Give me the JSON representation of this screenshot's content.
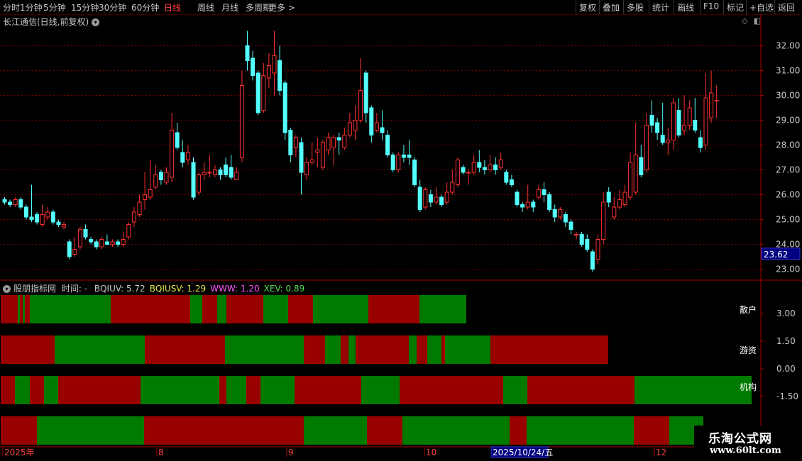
{
  "toolbar": {
    "periods": [
      "分时",
      "1分钟",
      "5分钟",
      "15分钟",
      "30分钟",
      "60分钟",
      "日线",
      "周线",
      "月线",
      "多周期",
      "更多 >"
    ],
    "active_period": "日线",
    "right_buttons": [
      "复权",
      "叠加",
      "多股",
      "统计",
      "画线",
      "F10",
      "标记",
      "+自选",
      "返回"
    ]
  },
  "chart_header": {
    "stock_title": "长江通信(日线,前复权)"
  },
  "indicator": {
    "name": "股朋指标网",
    "time_label": "时间: -",
    "values": [
      {
        "label": "BQIUV: 5.72",
        "color": "#c8c8c8"
      },
      {
        "label": "BQIUSV: 1.29",
        "color": "#e8e84a"
      },
      {
        "label": "WWW: 1.20",
        "color": "#ff55ff"
      },
      {
        "label": "XEV: 0.89",
        "color": "#55dd55"
      }
    ],
    "band_labels": [
      "散户",
      "游资",
      "机构"
    ],
    "y_labels": [
      "3.00",
      "1.50",
      "0.00",
      "-1.50"
    ],
    "bands": [
      {
        "name": "band-sanhu",
        "segments": [
          [
            "r",
            24
          ],
          [
            "g",
            3
          ],
          [
            "r",
            4
          ],
          [
            "g",
            3
          ],
          [
            "r",
            7
          ],
          [
            "g",
            114
          ],
          [
            "r",
            112
          ],
          [
            "g",
            17
          ],
          [
            "r",
            21
          ],
          [
            "g",
            13
          ],
          [
            "r",
            52
          ],
          [
            "g",
            35
          ],
          [
            "r",
            35
          ],
          [
            "g",
            78
          ],
          [
            "r",
            72
          ],
          [
            "g",
            66
          ]
        ]
      },
      {
        "name": "band-youzi",
        "segments": [
          [
            "r",
            76
          ],
          [
            "g",
            127
          ],
          [
            "r",
            113
          ],
          [
            "g",
            111
          ],
          [
            "r",
            30
          ],
          [
            "g",
            22
          ],
          [
            "r",
            11
          ],
          [
            "g",
            10
          ],
          [
            "r",
            75
          ],
          [
            "g",
            11
          ],
          [
            "r",
            15
          ],
          [
            "g",
            20
          ],
          [
            "r",
            5
          ],
          [
            "g",
            64
          ],
          [
            "r",
            166
          ]
        ]
      },
      {
        "name": "band-jigou",
        "segments": [
          [
            "r",
            20
          ],
          [
            "g",
            21
          ],
          [
            "r",
            20
          ],
          [
            "g",
            20
          ],
          [
            "r",
            116
          ],
          [
            "g",
            111
          ],
          [
            "r",
            10
          ],
          [
            "g",
            28
          ],
          [
            "r",
            20
          ],
          [
            "g",
            48
          ],
          [
            "r",
            94
          ],
          [
            "g",
            54
          ],
          [
            "r",
            146
          ],
          [
            "g",
            34
          ],
          [
            "r",
            151
          ],
          [
            "g",
            165
          ]
        ]
      },
      {
        "name": "band-bottom",
        "segments": [
          [
            "r",
            51
          ],
          [
            "g",
            151
          ],
          [
            "r",
            225
          ],
          [
            "g",
            89
          ],
          [
            "r",
            50
          ],
          [
            "g",
            151
          ],
          [
            "r",
            24
          ],
          [
            "g",
            151
          ],
          [
            "r",
            50
          ],
          [
            "g",
            48
          ]
        ]
      }
    ]
  },
  "price_axis": {
    "labels": [
      "32.00",
      "31.00",
      "30.00",
      "29.00",
      "28.00",
      "27.00",
      "26.00",
      "25.00",
      "24.00",
      "23.00"
    ],
    "current_price": "23.62"
  },
  "date_axis": {
    "labels": [
      "2025年",
      "8",
      "9",
      "10",
      "2025/10/24/五",
      "12"
    ]
  },
  "watermark": {
    "title": "乐淘公式网",
    "url": "www.60lt.com"
  },
  "chart_data": {
    "type": "candlestick",
    "y_range": [
      22.7,
      32.7
    ],
    "colors": {
      "up": "#ff3030",
      "down": "#54ffff"
    },
    "candles": [
      [
        25.8,
        25.7,
        25.9,
        25.6
      ],
      [
        25.7,
        25.6,
        25.8,
        25.5
      ],
      [
        25.6,
        25.8,
        25.9,
        25.5
      ],
      [
        25.8,
        25.5,
        25.9,
        25.4
      ],
      [
        25.5,
        25.1,
        25.6,
        25.0
      ],
      [
        25.1,
        25.0,
        26.4,
        24.9
      ],
      [
        25.2,
        24.9,
        25.3,
        24.8
      ],
      [
        24.8,
        25.2,
        25.6,
        24.7
      ],
      [
        25.1,
        25.3,
        25.5,
        25.0
      ],
      [
        25.3,
        24.9,
        25.4,
        24.8
      ],
      [
        24.9,
        24.8,
        25.0,
        24.7
      ],
      [
        24.7,
        24.8,
        24.9,
        24.6
      ],
      [
        24.1,
        23.5,
        24.2,
        23.4
      ],
      [
        23.6,
        23.8,
        24.3,
        23.5
      ],
      [
        23.9,
        24.6,
        24.7,
        23.8
      ],
      [
        24.6,
        24.3,
        24.8,
        24.2
      ],
      [
        24.2,
        24.1,
        24.3,
        24.0
      ],
      [
        24.1,
        23.9,
        24.2,
        23.8
      ],
      [
        23.9,
        24.2,
        24.3,
        23.8
      ],
      [
        24.1,
        24.0,
        24.4,
        24.0
      ],
      [
        24.0,
        24.1,
        24.2,
        23.9
      ],
      [
        24.1,
        24.0,
        24.2,
        23.9
      ],
      [
        24.0,
        24.2,
        24.5,
        23.9
      ],
      [
        24.3,
        24.8,
        24.9,
        24.2
      ],
      [
        24.9,
        25.3,
        25.5,
        24.7
      ],
      [
        25.2,
        25.7,
        26.0,
        25.1
      ],
      [
        25.8,
        26.0,
        26.9,
        25.4
      ],
      [
        25.9,
        26.2,
        27.4,
        25.8
      ],
      [
        26.3,
        26.8,
        27.2,
        26.2
      ],
      [
        26.9,
        26.6,
        27.0,
        26.4
      ],
      [
        26.5,
        26.9,
        27.1,
        26.4
      ],
      [
        26.7,
        28.6,
        29.3,
        26.5
      ],
      [
        28.5,
        27.9,
        28.9,
        27.8
      ],
      [
        27.7,
        27.3,
        28.2,
        27.1
      ],
      [
        27.4,
        27.7,
        28.0,
        27.2
      ],
      [
        27.3,
        25.9,
        27.5,
        25.8
      ],
      [
        26.1,
        26.8,
        26.9,
        26.0
      ],
      [
        26.8,
        26.9,
        27.3,
        26.6
      ],
      [
        26.9,
        26.9,
        27.6,
        26.7
      ],
      [
        26.8,
        27.0,
        27.2,
        26.7
      ],
      [
        27.0,
        26.8,
        27.1,
        26.6
      ],
      [
        27.2,
        26.8,
        27.5,
        26.7
      ],
      [
        27.1,
        26.7,
        27.6,
        26.6
      ],
      [
        26.6,
        26.9,
        27.1,
        26.6
      ],
      [
        27.5,
        30.4,
        31.0,
        27.3
      ],
      [
        32.0,
        31.4,
        32.6,
        31.0
      ],
      [
        31.5,
        30.8,
        31.8,
        30.6
      ],
      [
        30.9,
        29.3,
        31.0,
        29.2
      ],
      [
        29.4,
        30.8,
        31.3,
        29.3
      ],
      [
        30.7,
        31.2,
        31.7,
        30.3
      ],
      [
        30.9,
        31.6,
        32.6,
        30.0
      ],
      [
        31.4,
        30.2,
        32.0,
        30.0
      ],
      [
        30.5,
        28.5,
        30.6,
        28.2
      ],
      [
        28.6,
        27.6,
        28.7,
        27.3
      ],
      [
        27.9,
        28.3,
        28.4,
        27.5
      ],
      [
        28.1,
        26.9,
        28.3,
        26.0
      ],
      [
        26.8,
        27.3,
        27.5,
        26.6
      ],
      [
        27.3,
        27.4,
        28.1,
        27.2
      ],
      [
        27.7,
        27.8,
        28.3,
        27.1
      ],
      [
        27.1,
        28.1,
        28.2,
        27.0
      ],
      [
        27.8,
        28.3,
        28.5,
        27.6
      ],
      [
        27.9,
        28.3,
        28.4,
        27.2
      ],
      [
        28.3,
        28.2,
        28.5,
        27.6
      ],
      [
        27.9,
        28.4,
        28.7,
        27.8
      ],
      [
        28.4,
        28.9,
        29.3,
        28.3
      ],
      [
        28.6,
        29.0,
        29.6,
        28.2
      ],
      [
        29.0,
        30.2,
        31.5,
        28.9
      ],
      [
        30.9,
        29.3,
        31.0,
        28.9
      ],
      [
        29.5,
        28.4,
        29.6,
        28.1
      ],
      [
        28.6,
        28.9,
        29.3,
        28.5
      ],
      [
        28.7,
        28.5,
        29.4,
        28.2
      ],
      [
        28.4,
        27.6,
        28.6,
        27.5
      ],
      [
        27.6,
        27.0,
        27.7,
        26.9
      ],
      [
        27.0,
        27.6,
        27.7,
        26.9
      ],
      [
        27.6,
        27.5,
        28.0,
        27.3
      ],
      [
        27.6,
        27.5,
        28.2,
        27.2
      ],
      [
        27.4,
        26.4,
        27.5,
        26.3
      ],
      [
        26.3,
        25.4,
        26.6,
        25.3
      ],
      [
        25.5,
        26.2,
        26.3,
        25.4
      ],
      [
        26.0,
        25.7,
        26.2,
        25.5
      ],
      [
        25.7,
        25.9,
        26.3,
        25.6
      ],
      [
        25.9,
        25.6,
        26.0,
        25.5
      ],
      [
        25.7,
        26.1,
        26.5,
        25.6
      ],
      [
        26.1,
        26.5,
        27.0,
        26.0
      ],
      [
        26.4,
        27.4,
        27.5,
        26.3
      ],
      [
        27.1,
        26.9,
        27.2,
        26.8
      ],
      [
        26.9,
        26.9,
        27.0,
        26.4
      ],
      [
        26.9,
        27.3,
        27.6,
        26.8
      ],
      [
        27.3,
        27.1,
        27.8,
        26.9
      ],
      [
        27.1,
        27.0,
        27.4,
        26.8
      ],
      [
        27.0,
        27.2,
        27.6,
        26.9
      ],
      [
        27.2,
        27.0,
        27.5,
        26.8
      ],
      [
        27.1,
        27.4,
        27.7,
        27.0
      ],
      [
        26.9,
        26.5,
        27.0,
        26.4
      ],
      [
        26.6,
        26.4,
        26.8,
        26.3
      ],
      [
        26.1,
        25.6,
        26.2,
        25.5
      ],
      [
        25.6,
        25.5,
        25.7,
        25.3
      ],
      [
        25.5,
        25.7,
        26.4,
        25.4
      ],
      [
        25.7,
        25.5,
        25.8,
        25.3
      ],
      [
        25.9,
        26.2,
        26.4,
        25.8
      ],
      [
        26.2,
        26.0,
        26.5,
        25.7
      ],
      [
        26.0,
        25.4,
        26.1,
        25.3
      ],
      [
        25.4,
        25.1,
        25.6,
        24.9
      ],
      [
        25.1,
        25.4,
        25.5,
        25.0
      ],
      [
        25.2,
        24.9,
        25.3,
        24.7
      ],
      [
        24.9,
        24.6,
        25.0,
        24.4
      ],
      [
        24.4,
        24.4,
        24.5,
        24.2
      ],
      [
        24.4,
        24.0,
        24.5,
        23.9
      ],
      [
        24.2,
        23.8,
        24.4,
        23.7
      ],
      [
        23.7,
        23.0,
        23.8,
        22.9
      ],
      [
        23.4,
        24.2,
        24.4,
        23.2
      ],
      [
        24.2,
        25.7,
        26.1,
        24.0
      ],
      [
        26.1,
        25.7,
        26.3,
        25.5
      ],
      [
        25.1,
        25.5,
        25.9,
        25.0
      ],
      [
        25.5,
        25.8,
        26.2,
        25.4
      ],
      [
        25.6,
        26.1,
        26.4,
        25.5
      ],
      [
        25.9,
        27.3,
        27.7,
        25.8
      ],
      [
        26.1,
        27.6,
        28.9,
        26.0
      ],
      [
        27.5,
        26.8,
        28.0,
        26.7
      ],
      [
        27.0,
        28.8,
        29.3,
        26.9
      ],
      [
        29.2,
        28.8,
        29.8,
        28.5
      ],
      [
        28.9,
        28.5,
        29.1,
        28.2
      ],
      [
        28.4,
        28.1,
        29.7,
        28.0
      ],
      [
        28.1,
        28.2,
        28.7,
        27.6
      ],
      [
        28.2,
        29.7,
        29.9,
        27.8
      ],
      [
        29.4,
        28.4,
        29.9,
        28.3
      ],
      [
        28.6,
        28.8,
        30.0,
        28.4
      ],
      [
        28.8,
        29.5,
        29.8,
        28.6
      ],
      [
        29.0,
        28.6,
        29.9,
        28.5
      ],
      [
        28.3,
        27.9,
        28.6,
        27.7
      ],
      [
        28.0,
        29.9,
        30.9,
        27.8
      ],
      [
        29.1,
        30.1,
        31.0,
        28.9
      ],
      [
        29.8,
        29.8,
        30.4,
        29.1
      ]
    ]
  }
}
